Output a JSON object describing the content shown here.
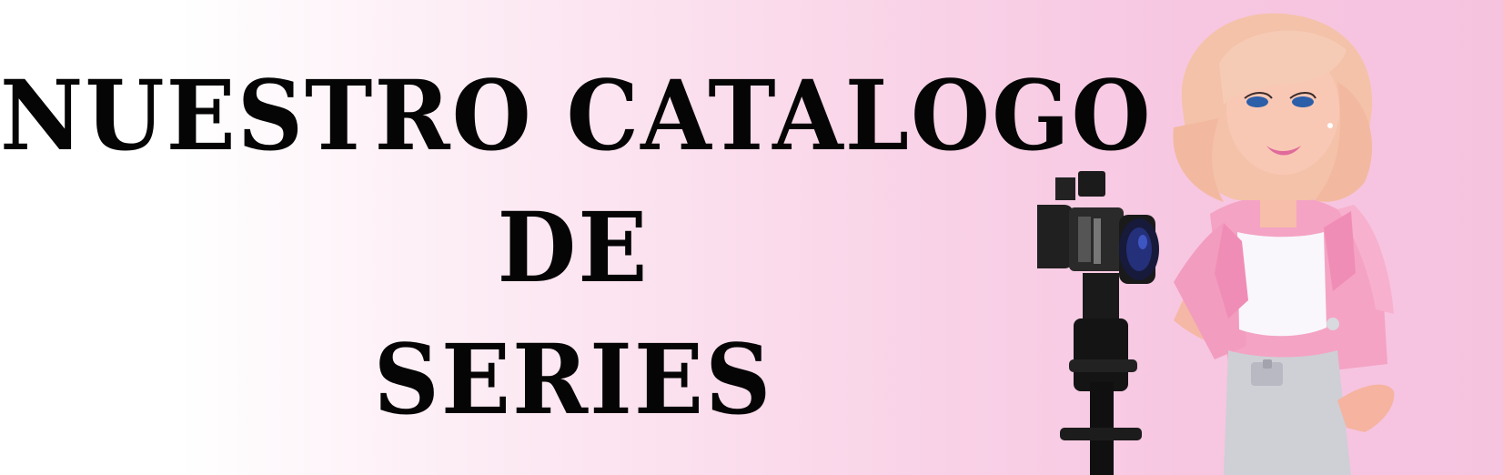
{
  "banner": {
    "title_line_1": "NUESTRO  CATALOGO",
    "title_line_2": "DE",
    "title_line_3": "SERIES"
  },
  "colors": {
    "gradient_start": "#ffffff",
    "gradient_end": "#f6c3df",
    "title_text": "#050505"
  },
  "illustration": {
    "subject": "doll-with-video-camera"
  }
}
